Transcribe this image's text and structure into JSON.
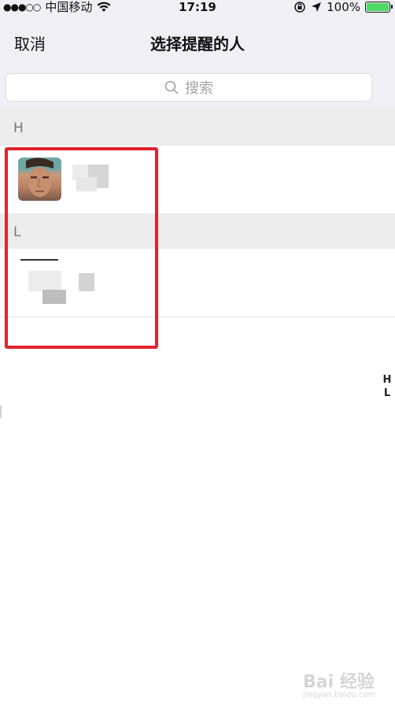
{
  "status_bar": {
    "signal": "●●●○○",
    "carrier": "中国移动",
    "time": "17:19",
    "battery": "100%",
    "battery_level": 1.0,
    "battery_color": "#4cd964"
  },
  "navbar": {
    "cancel_label": "取消",
    "title": "选择提醒的人"
  },
  "search": {
    "placeholder": "搜索",
    "icon": "search-icon"
  },
  "sections": [
    {
      "letter": "H"
    },
    {
      "letter": "L"
    }
  ],
  "index_bar": [
    "H",
    "L"
  ],
  "highlight_color": "#e0232d",
  "watermark": {
    "brand": "Bai 经验",
    "url": "jingyan.baidu.com"
  }
}
